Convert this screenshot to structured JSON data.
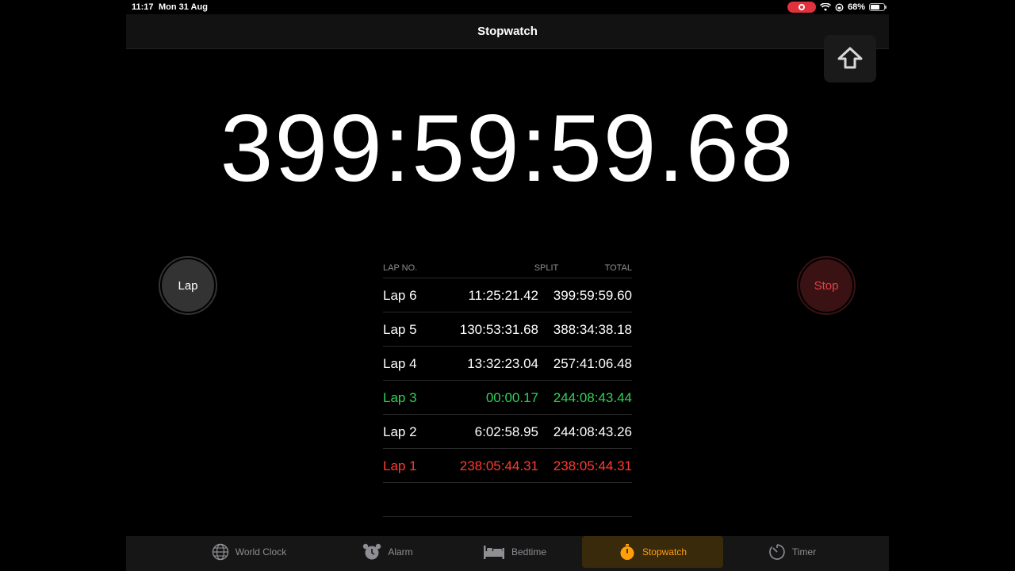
{
  "status": {
    "time": "11:17",
    "date": "Mon 31 Aug",
    "battery": "68%",
    "battery_level": 0.68
  },
  "nav": {
    "title": "Stopwatch"
  },
  "icons": {
    "share": "share-upload-icon",
    "record": "screen-record-icon",
    "wifi": "wifi-icon",
    "lock": "orientation-lock-icon"
  },
  "stopwatch": {
    "display": "399:59:59.68",
    "lap_label": "Lap",
    "stop_label": "Stop"
  },
  "laps": {
    "headers": {
      "no": "LAP NO.",
      "split": "SPLIT",
      "total": "TOTAL"
    },
    "rows": [
      {
        "name": "Lap 6",
        "split": "11:25:21.42",
        "total": "399:59:59.60",
        "state": "normal"
      },
      {
        "name": "Lap 5",
        "split": "130:53:31.68",
        "total": "388:34:38.18",
        "state": "normal"
      },
      {
        "name": "Lap 4",
        "split": "13:32:23.04",
        "total": "257:41:06.48",
        "state": "normal"
      },
      {
        "name": "Lap 3",
        "split": "00:00.17",
        "total": "244:08:43.44",
        "state": "fastest"
      },
      {
        "name": "Lap 2",
        "split": "6:02:58.95",
        "total": "244:08:43.26",
        "state": "normal"
      },
      {
        "name": "Lap 1",
        "split": "238:05:44.31",
        "total": "238:05:44.31",
        "state": "slowest"
      }
    ]
  },
  "tabs": [
    {
      "label": "World Clock",
      "icon": "globe-icon",
      "active": false
    },
    {
      "label": "Alarm",
      "icon": "alarm-clock-icon",
      "active": false
    },
    {
      "label": "Bedtime",
      "icon": "bed-icon",
      "active": false
    },
    {
      "label": "Stopwatch",
      "icon": "stopwatch-icon",
      "active": true
    },
    {
      "label": "Timer",
      "icon": "timer-icon",
      "active": false
    }
  ],
  "colors": {
    "accent": "#ff9f0a",
    "fastest": "#30d158",
    "slowest": "#ff3b30",
    "stop": "#e5404a"
  }
}
